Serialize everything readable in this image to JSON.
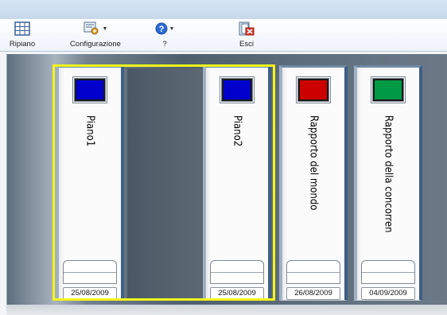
{
  "toolbar": {
    "buttons": [
      {
        "label": "Ripiano",
        "icon": "grid-icon"
      },
      {
        "label": "Configurazione",
        "icon": "settings-icon",
        "dropdown": true
      },
      {
        "label": "?",
        "icon": "help-icon",
        "dropdown": true
      },
      {
        "label": "Esci",
        "icon": "exit-icon"
      }
    ]
  },
  "binders": [
    {
      "title": "Piano1",
      "color": "#0000cc",
      "date": "25/08/2009",
      "selected": true
    },
    {
      "title": "Piano2",
      "color": "#0000cc",
      "date": "25/08/2009",
      "selected": true
    },
    {
      "title": "Rapporto del mondo",
      "color": "#cc0000",
      "date": "26/08/2009",
      "selected": false
    },
    {
      "title": "Rapporto della concorren",
      "color": "#009944",
      "date": "04/09/2009",
      "selected": false
    }
  ],
  "colors": {
    "selection": "#f5f51a"
  }
}
